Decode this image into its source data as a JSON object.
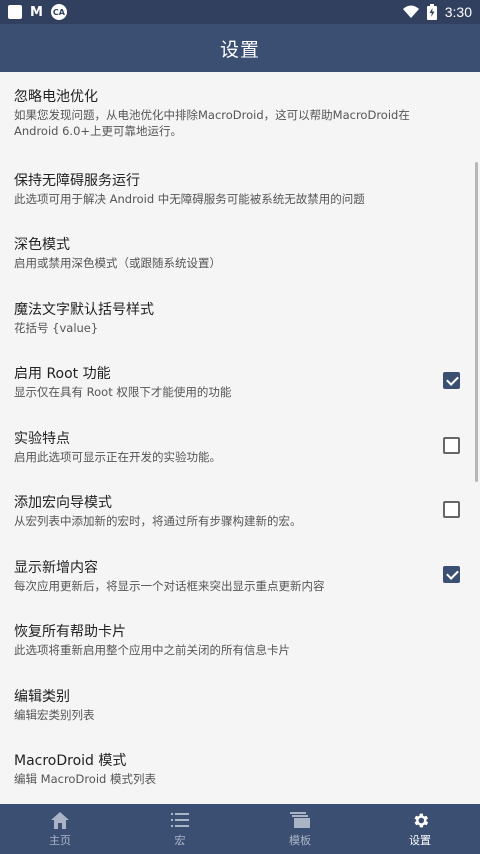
{
  "status_bar": {
    "time": "3:30",
    "m_label": "M",
    "circle_label": "CA"
  },
  "app_bar": {
    "title": "设置"
  },
  "settings": [
    {
      "title": "忽略电池优化",
      "subtitle": "如果您发现问题，从电池优化中排除MacroDroid，这可以帮助MacroDroid在Android 6.0+上更可靠地运行。",
      "checkbox": null
    },
    {
      "title": "保持无障碍服务运行",
      "subtitle": "此选项可用于解决 Android 中无障碍服务可能被系统无故禁用的问题",
      "checkbox": null
    },
    {
      "title": "深色模式",
      "subtitle": "启用或禁用深色模式（或跟随系统设置）",
      "checkbox": null
    },
    {
      "title": "魔法文字默认括号样式",
      "subtitle": "花括号 {value}",
      "checkbox": null
    },
    {
      "title": "启用 Root 功能",
      "subtitle": "显示仅在具有 Root 权限下才能使用的功能",
      "checkbox": true
    },
    {
      "title": "实验特点",
      "subtitle": "启用此选项可显示正在开发的实验功能。",
      "checkbox": false
    },
    {
      "title": "添加宏向导模式",
      "subtitle": "从宏列表中添加新的宏时，将通过所有步骤构建新的宏。",
      "checkbox": false
    },
    {
      "title": "显示新增内容",
      "subtitle": "每次应用更新后，将显示一个对话框来突出显示重点更新内容",
      "checkbox": true
    },
    {
      "title": "恢复所有帮助卡片",
      "subtitle": "此选项将重新启用整个应用中之前关闭的所有信息卡片",
      "checkbox": null
    },
    {
      "title": "编辑类别",
      "subtitle": "编辑宏类别列表",
      "checkbox": null
    },
    {
      "title": "MacroDroid 模式",
      "subtitle": "编辑 MacroDroid 模式列表",
      "checkbox": null
    }
  ],
  "bottom_nav": [
    {
      "label": "主页",
      "icon": "home-icon",
      "active": false
    },
    {
      "label": "宏",
      "icon": "list-icon",
      "active": false
    },
    {
      "label": "模板",
      "icon": "templates-icon",
      "active": false
    },
    {
      "label": "设置",
      "icon": "gear-icon",
      "active": true
    }
  ],
  "colors": {
    "status_bar": "#31405e",
    "app_bar": "#3b4f72",
    "accent": "#3b4f72"
  }
}
